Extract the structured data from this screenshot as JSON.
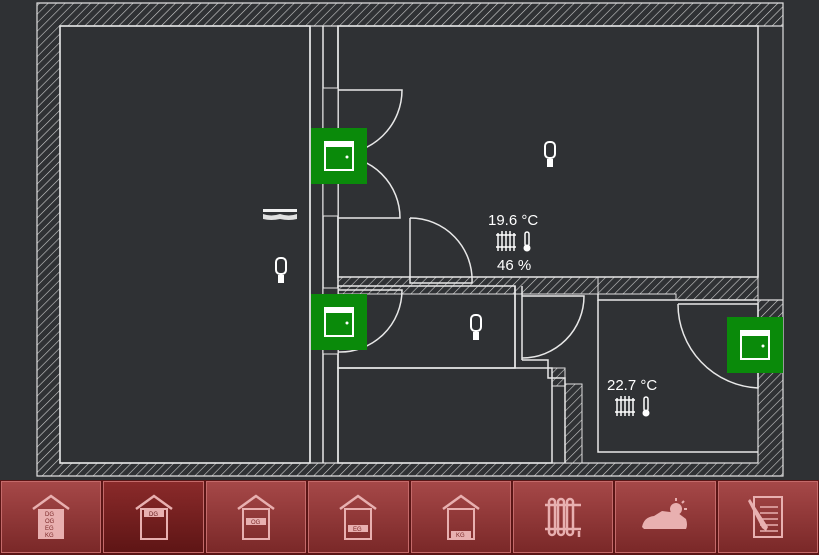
{
  "rooms": {
    "upper_right": {
      "temperature": "19.6 °C",
      "humidity": "46 %"
    },
    "lower_right": {
      "temperature": "22.7 °C"
    }
  },
  "windows": [
    {
      "id": "window-1",
      "state": "closed",
      "color": "#0a8a0a"
    },
    {
      "id": "window-2",
      "state": "closed",
      "color": "#0a8a0a"
    },
    {
      "id": "window-3",
      "state": "closed",
      "color": "#0a8a0a"
    }
  ],
  "navbar": {
    "items": [
      {
        "icon": "house-all-floors-icon",
        "floors": [
          "DG",
          "OG",
          "EG",
          "KG"
        ]
      },
      {
        "icon": "house-dg-icon",
        "label": "DG"
      },
      {
        "icon": "house-og-icon",
        "label": "OG"
      },
      {
        "icon": "house-eg-icon",
        "label": "EG"
      },
      {
        "icon": "house-kg-icon",
        "label": "KG"
      },
      {
        "icon": "radiator-icon"
      },
      {
        "icon": "car-weather-icon"
      },
      {
        "icon": "notepad-icon"
      }
    ],
    "active_index": 1,
    "color": "#a64848"
  }
}
